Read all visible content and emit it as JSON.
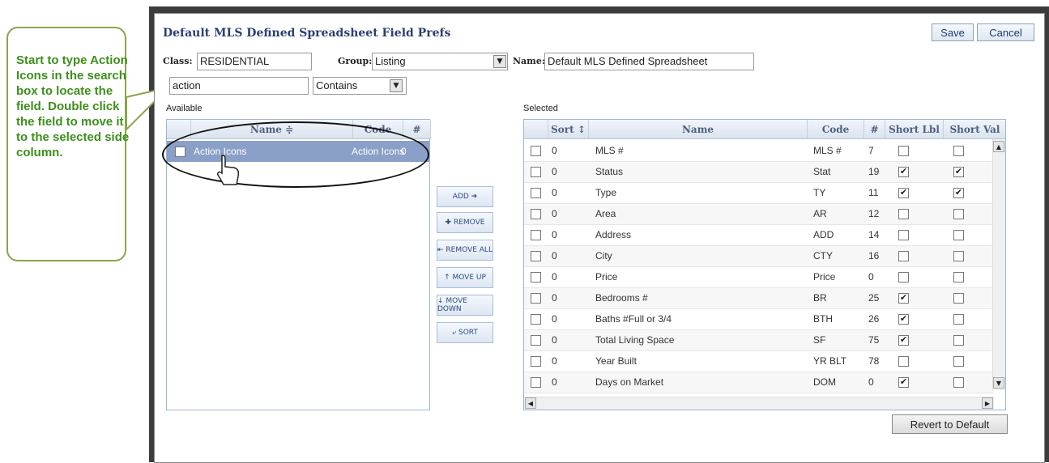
{
  "dialog": {
    "title": "Default MLS Defined Spreadsheet Field Prefs",
    "save_label": "Save",
    "cancel_label": "Cancel",
    "revert_label": "Revert to Default"
  },
  "form": {
    "class_label": "Class:",
    "class_value": "RESIDENTIAL",
    "group_label": "Group:",
    "group_value": "Listing",
    "name_label": "Name:",
    "name_value": "Default MLS Defined Spreadsheet",
    "search_value": "action",
    "filter_value": "Contains"
  },
  "available": {
    "label": "Available",
    "headers": [
      "Name ≑",
      "Code",
      "#"
    ],
    "rows": [
      {
        "name": "Action Icons",
        "code": "Action Icons",
        "num": "0"
      }
    ]
  },
  "buttons": {
    "add": "ADD ➜",
    "remove": "✚ REMOVE",
    "remove_all": "⇤ REMOVE ALL",
    "move_up": "↑ MOVE UP",
    "move_down": "↓ MOVE DOWN",
    "sort": "⤶ SORT"
  },
  "selected": {
    "label": "Selected",
    "headers": [
      "Sort ↕",
      "Name",
      "Code",
      "#",
      "Short Lbl",
      "Short Val"
    ],
    "rows": [
      {
        "sort": "0",
        "name": "MLS #",
        "code": "MLS #",
        "num": "7",
        "lbl": false,
        "val": false
      },
      {
        "sort": "0",
        "name": "Status",
        "code": "Stat",
        "num": "19",
        "lbl": true,
        "val": true
      },
      {
        "sort": "0",
        "name": "Type",
        "code": "TY",
        "num": "11",
        "lbl": true,
        "val": true
      },
      {
        "sort": "0",
        "name": "Area",
        "code": "AR",
        "num": "12",
        "lbl": false,
        "val": false
      },
      {
        "sort": "0",
        "name": "Address",
        "code": "ADD",
        "num": "14",
        "lbl": false,
        "val": false
      },
      {
        "sort": "0",
        "name": "City",
        "code": "CTY",
        "num": "16",
        "lbl": false,
        "val": false
      },
      {
        "sort": "0",
        "name": "Price",
        "code": "Price",
        "num": "0",
        "lbl": false,
        "val": false
      },
      {
        "sort": "0",
        "name": "Bedrooms #",
        "code": "BR",
        "num": "25",
        "lbl": true,
        "val": false
      },
      {
        "sort": "0",
        "name": "Baths #Full or 3/4",
        "code": "BTH",
        "num": "26",
        "lbl": true,
        "val": false
      },
      {
        "sort": "0",
        "name": "Total Living Space",
        "code": "SF",
        "num": "75",
        "lbl": true,
        "val": false
      },
      {
        "sort": "0",
        "name": "Year Built",
        "code": "YR BLT",
        "num": "78",
        "lbl": false,
        "val": false
      },
      {
        "sort": "0",
        "name": "Days on Market",
        "code": "DOM",
        "num": "0",
        "lbl": true,
        "val": false
      }
    ]
  },
  "callout": {
    "text": "Start to type Action Icons in the search box to locate the field. Double click the field to move it to the selected side column."
  }
}
